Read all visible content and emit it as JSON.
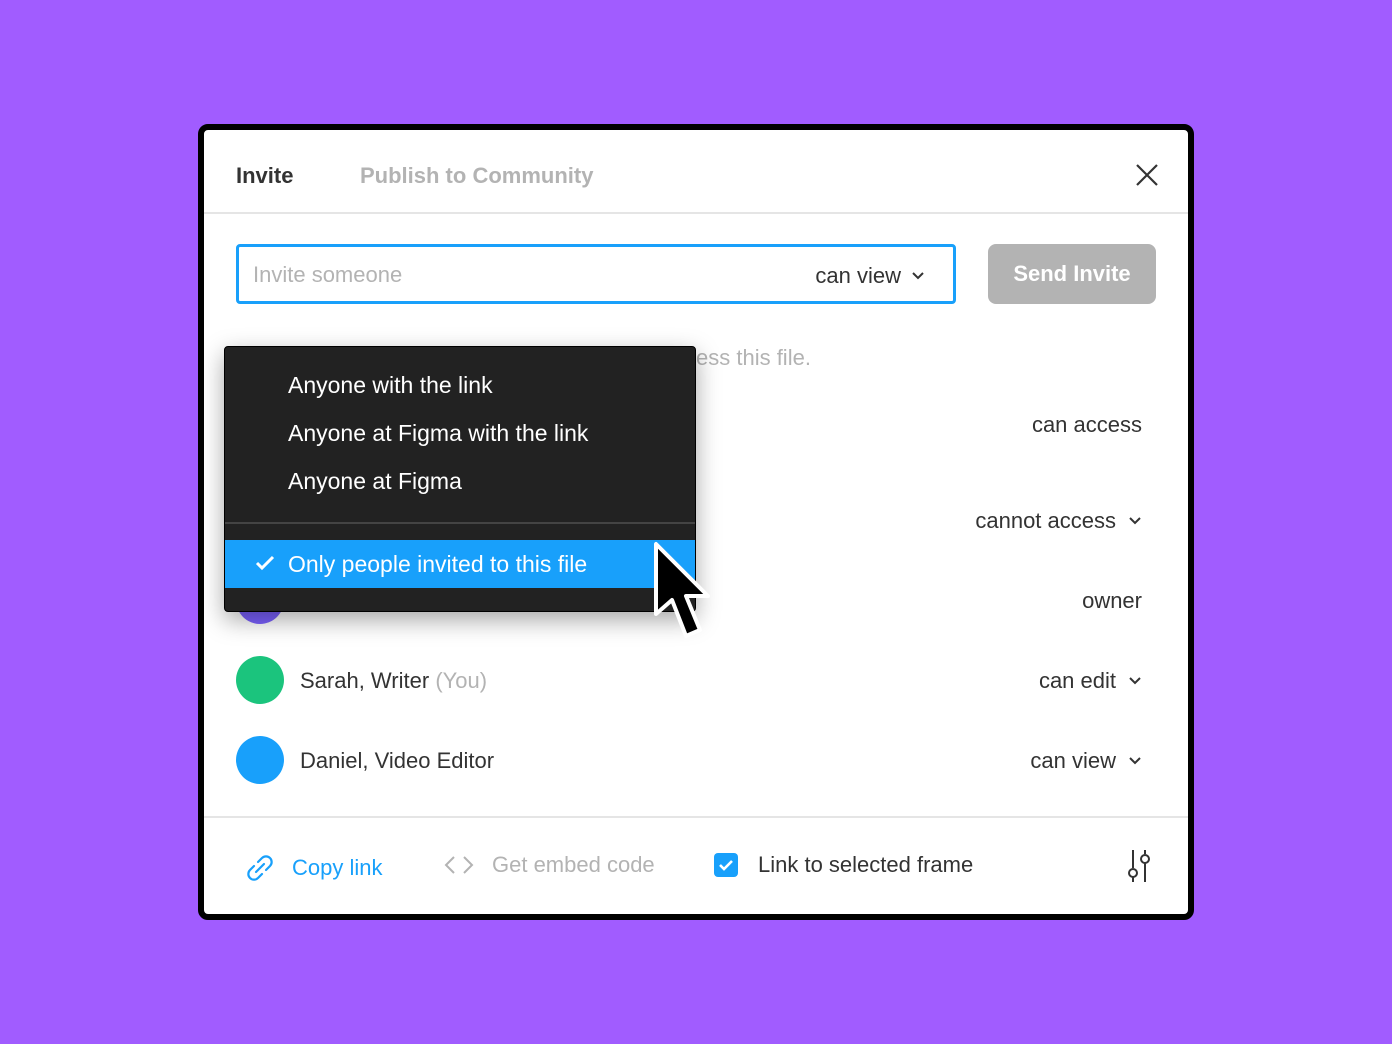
{
  "header": {
    "tabs": [
      {
        "label": "Invite",
        "active": true
      },
      {
        "label": "Publish to Community",
        "active": false
      }
    ],
    "close_icon": "close-icon"
  },
  "invite": {
    "placeholder": "Invite someone",
    "permission": "can view",
    "send_label": "Send Invite"
  },
  "helper_text": "ess this file.",
  "access_rows": [
    {
      "permission": "can access"
    },
    {
      "permission": "cannot access"
    }
  ],
  "members": [
    {
      "permission": "owner",
      "avatar_color": "#7b61ff"
    },
    {
      "name": "Sarah, Writer",
      "you_label": "(You)",
      "permission": "can edit",
      "avatar_color": "#1bc47d"
    },
    {
      "name": "Daniel, Video Editor",
      "permission": "can view",
      "avatar_color": "#18a0fb"
    }
  ],
  "footer": {
    "copy_link": "Copy link",
    "embed": "Get embed code",
    "link_frame": "Link to selected frame",
    "link_frame_checked": true
  },
  "dropdown": {
    "options": [
      {
        "label": "Anyone with the link",
        "selected": false
      },
      {
        "label": "Anyone at Figma with the link",
        "selected": false
      },
      {
        "label": "Anyone at Figma",
        "selected": false
      },
      {
        "label": "Only people invited to this file",
        "selected": true
      }
    ]
  },
  "colors": {
    "background": "#a15cff",
    "accent": "#18a0fb",
    "menu_bg": "#222222",
    "muted": "#b3b3b3"
  }
}
